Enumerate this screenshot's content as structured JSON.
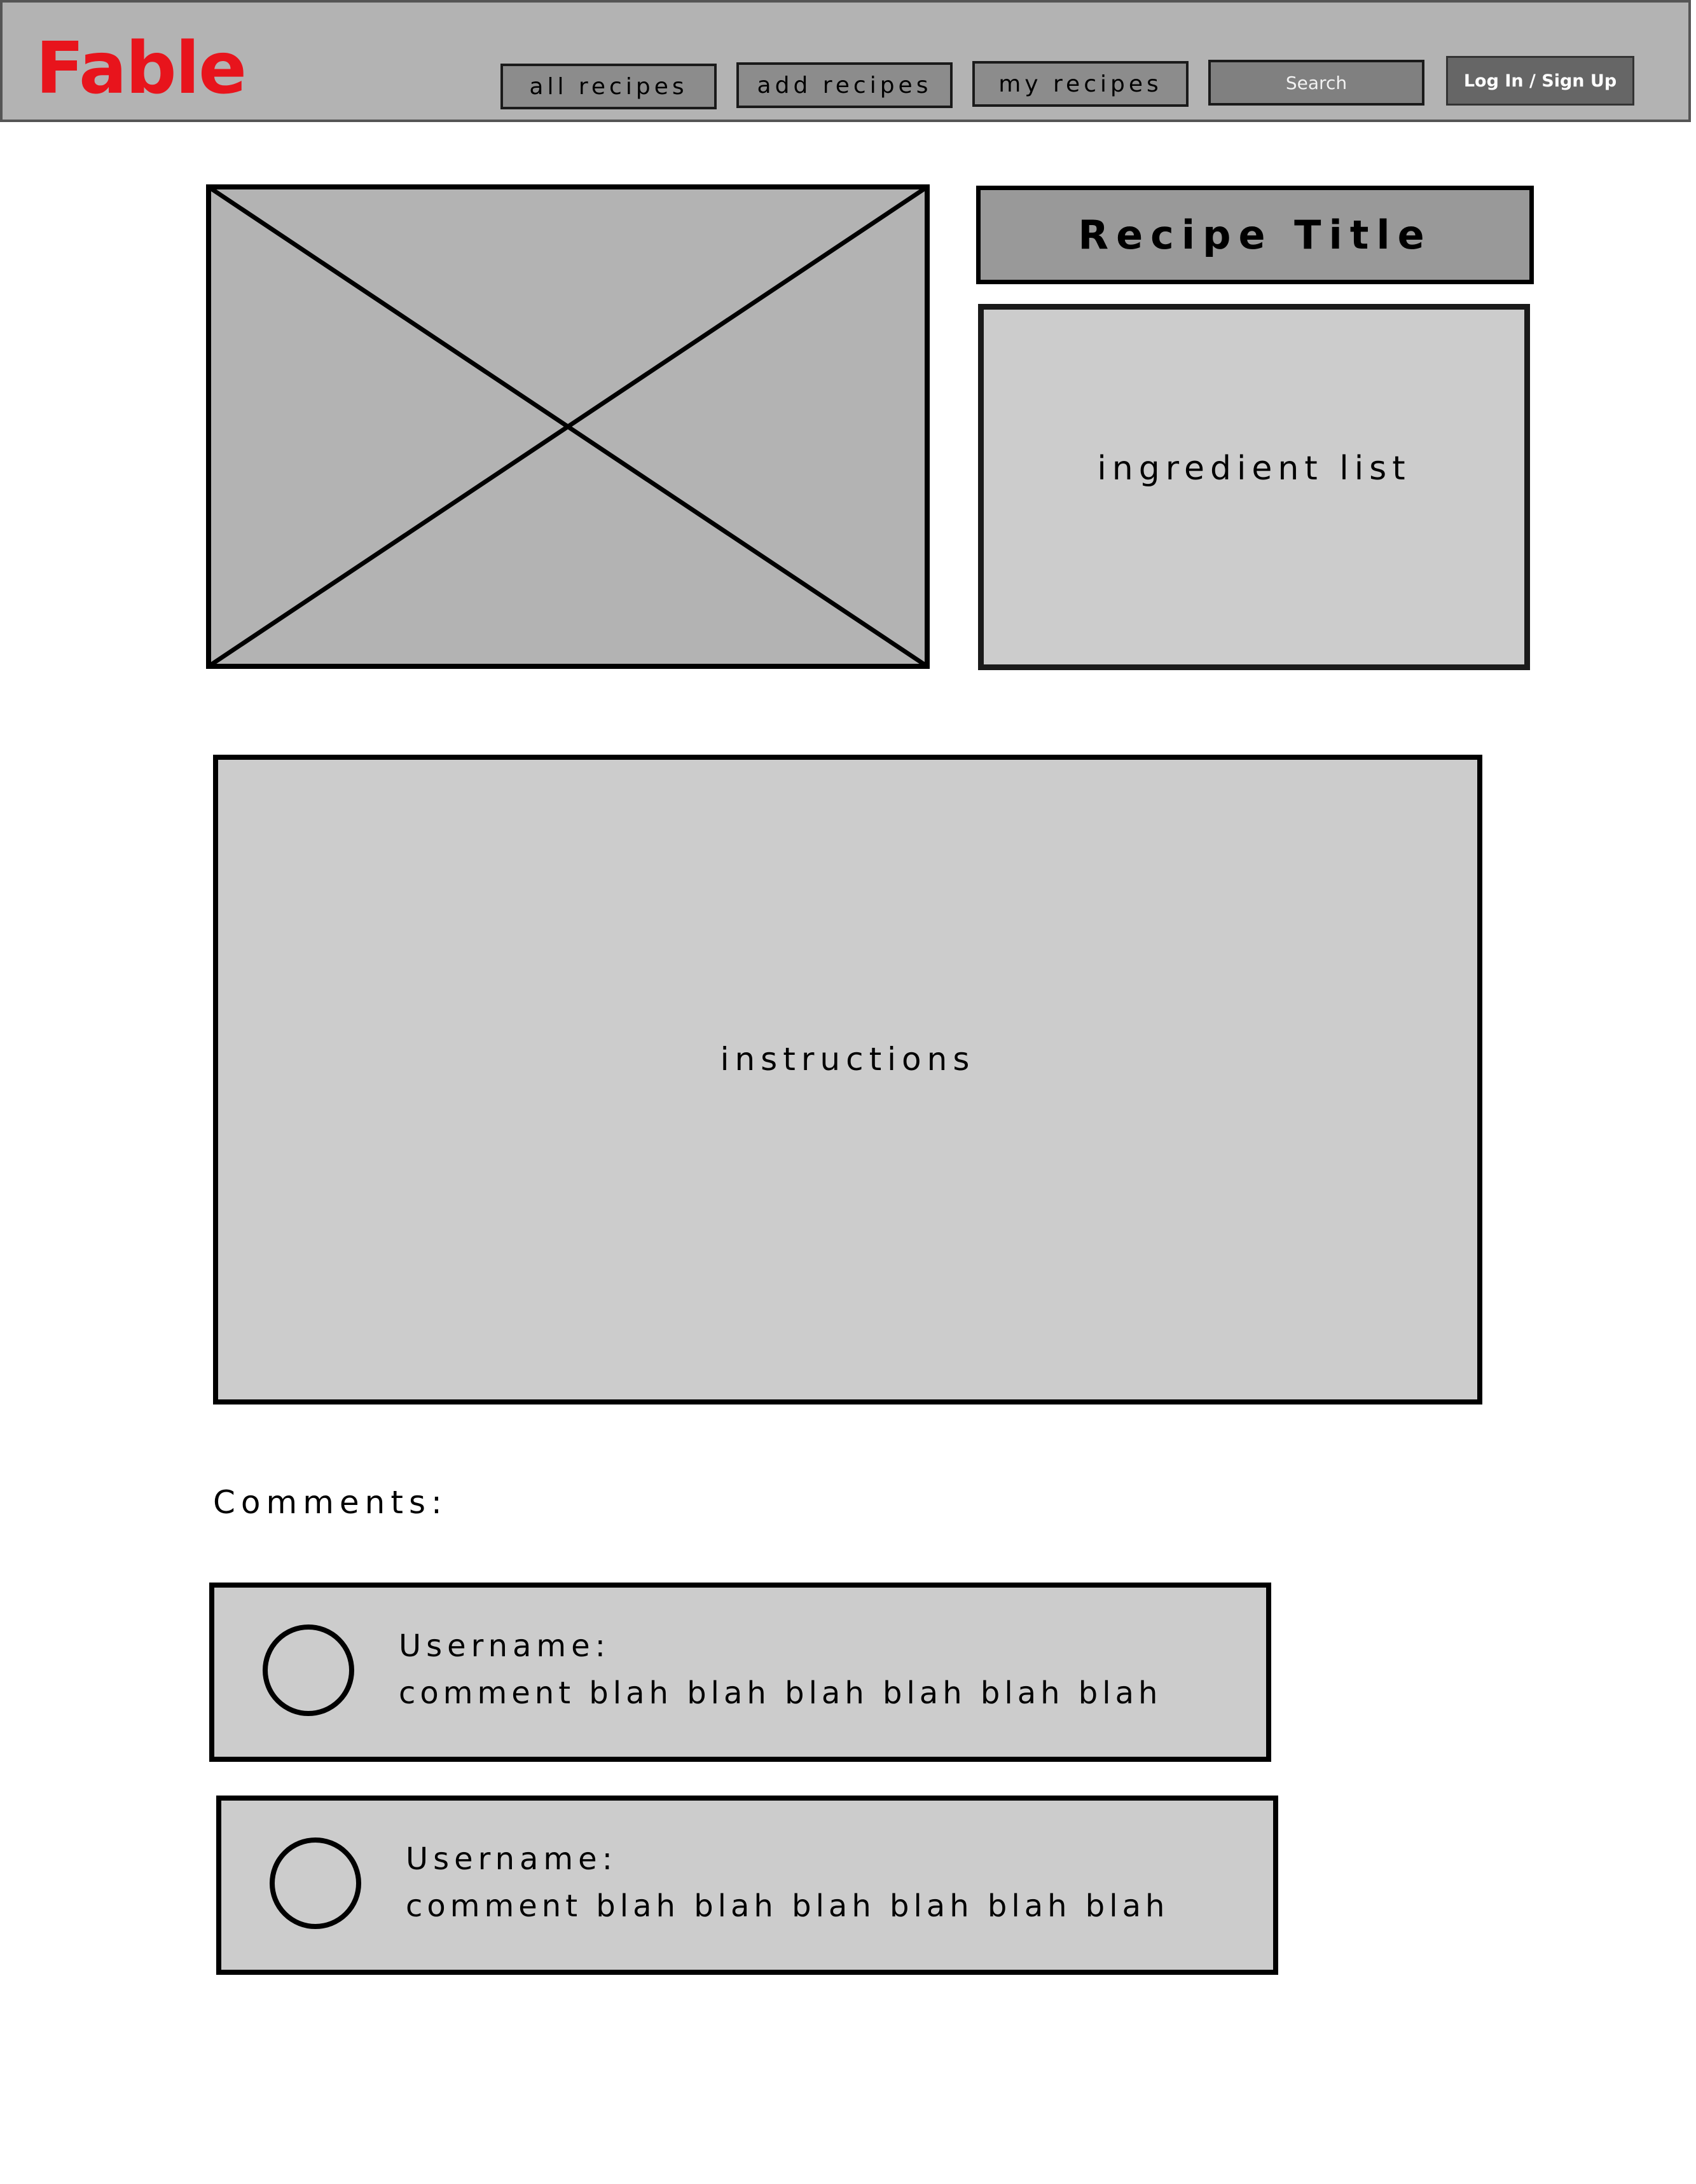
{
  "header": {
    "logo": "Fable",
    "nav": [
      {
        "label": "all recipes"
      },
      {
        "label": "add recipes"
      },
      {
        "label": "my recipes"
      }
    ],
    "search": {
      "placeholder": "Search",
      "value": ""
    },
    "login_label": "Log In / Sign Up"
  },
  "recipe": {
    "title": "Recipe Title",
    "ingredients_label": "ingredient list",
    "instructions_label": "instructions"
  },
  "comments": {
    "heading": "Comments:",
    "items": [
      {
        "username": "Username:",
        "text": "comment blah blah blah blah blah blah"
      },
      {
        "username": "Username:",
        "text": "comment blah blah blah blah blah blah"
      }
    ]
  },
  "colors": {
    "logo": "#e8141c",
    "navbar_bg": "#b3b3b3",
    "nav_button_bg": "#8c8c8c",
    "search_bg": "#808080",
    "login_bg": "#666666",
    "image_placeholder_bg": "#b3b3b3",
    "title_bg": "#999999",
    "panel_bg": "#cccccc"
  },
  "icons": {
    "image_placeholder": "image-placeholder-icon",
    "avatar": "user-avatar-icon"
  }
}
